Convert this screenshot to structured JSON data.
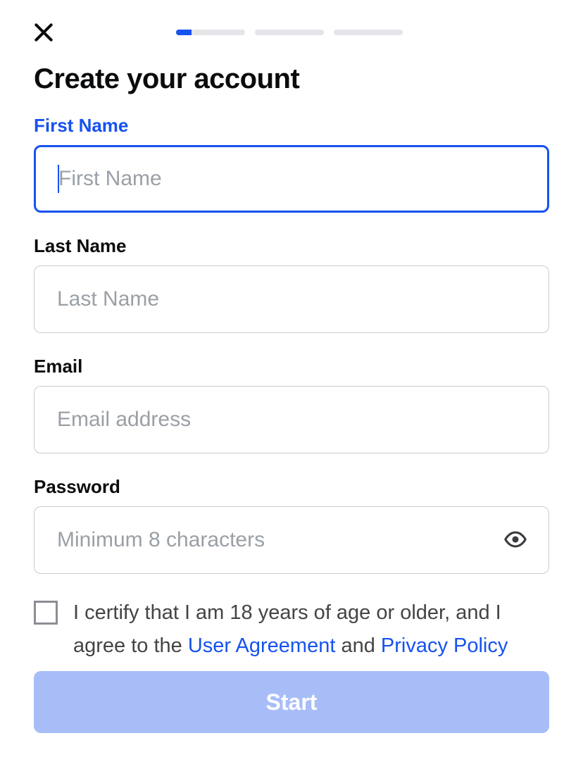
{
  "progress": {
    "steps_total": 3,
    "step1_fill_percent": 22
  },
  "title": "Create your account",
  "fields": {
    "first_name": {
      "label": "First Name",
      "placeholder": "First Name",
      "value": ""
    },
    "last_name": {
      "label": "Last Name",
      "placeholder": "Last Name",
      "value": ""
    },
    "email": {
      "label": "Email",
      "placeholder": "Email address",
      "value": ""
    },
    "password": {
      "label": "Password",
      "placeholder": "Minimum 8 characters",
      "value": ""
    }
  },
  "consent": {
    "text_part1": "I certify that I am 18 years of age or older, and I agree to the ",
    "link1": "User Agreement",
    "text_part2": " and ",
    "link2": "Privacy Policy"
  },
  "actions": {
    "primary_label": "Start"
  },
  "state": {
    "focused_field": "first_name",
    "consent_checked": false,
    "primary_enabled": false
  }
}
